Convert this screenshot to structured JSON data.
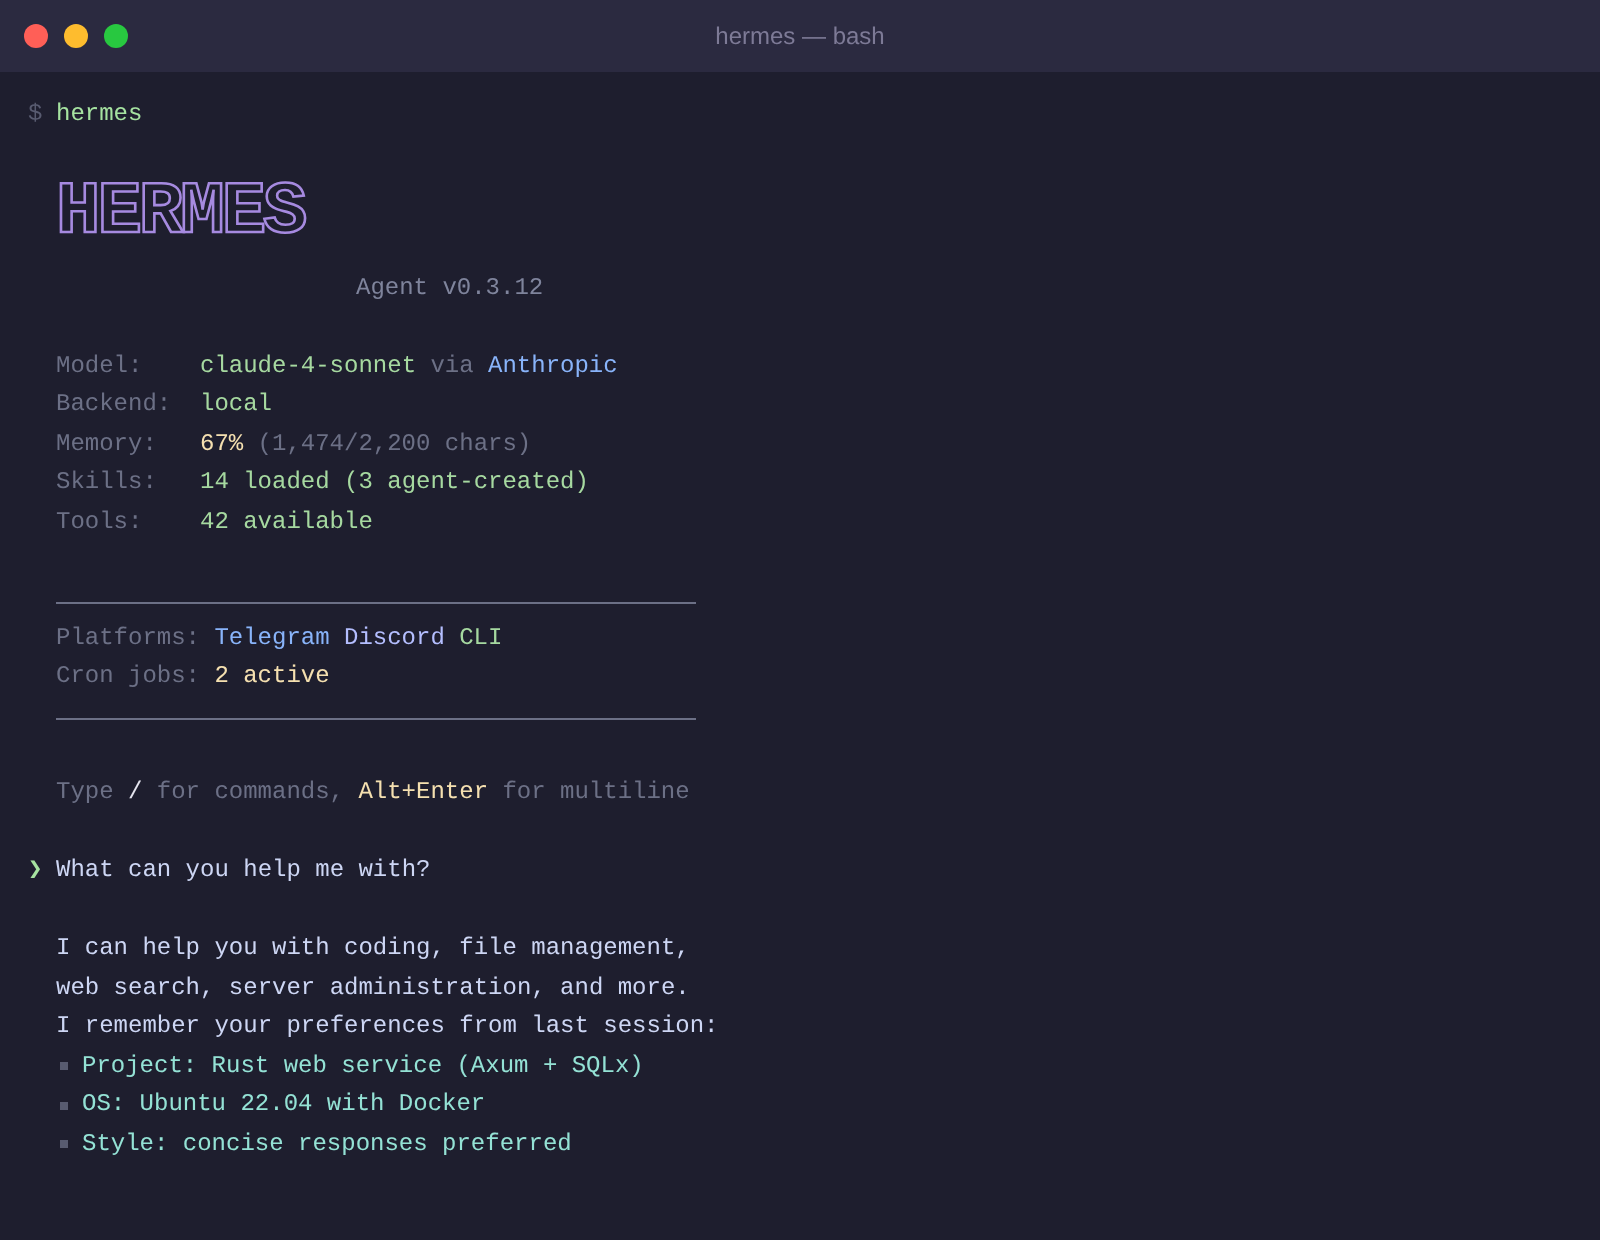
{
  "window": {
    "title": "hermes — bash"
  },
  "command": {
    "prompt": "$",
    "text": "hermes"
  },
  "banner": {
    "logo": "HERMES",
    "version": "Agent v0.3.12"
  },
  "info_rows": [
    {
      "label": "Model:",
      "parts": [
        {
          "text": "claude-4-sonnet",
          "kind": "value"
        },
        {
          "text": "via",
          "kind": "muted"
        },
        {
          "text": "Anthropic",
          "kind": "link"
        }
      ]
    },
    {
      "label": "Backend:",
      "parts": [
        {
          "text": "local",
          "kind": "value"
        }
      ]
    },
    {
      "label": "Memory:",
      "parts": [
        {
          "text": "67%",
          "kind": "highlight"
        },
        {
          "text": "(1,474/2,200 chars)",
          "kind": "muted"
        }
      ]
    },
    {
      "label": "Skills:",
      "parts": [
        {
          "text": "14 loaded (3 agent-created)",
          "kind": "value"
        }
      ]
    },
    {
      "label": "Tools:",
      "parts": [
        {
          "text": "42 available",
          "kind": "value"
        }
      ]
    }
  ],
  "status_rows": [
    {
      "label": "Platforms:",
      "parts": [
        {
          "text": "Telegram",
          "kind": "link"
        },
        {
          "text": "Discord",
          "kind": "accent"
        },
        {
          "text": "CLI",
          "kind": "value"
        }
      ]
    },
    {
      "label": "Cron jobs:",
      "parts": [
        {
          "text": "2 active",
          "kind": "highlight"
        }
      ]
    }
  ],
  "hint": [
    {
      "text": "Type",
      "kind": "muted"
    },
    {
      "text": "/",
      "kind": "bright"
    },
    {
      "text": "for commands,",
      "kind": "muted"
    },
    {
      "text": "Alt+Enter",
      "kind": "highlight"
    },
    {
      "text": "for multiline",
      "kind": "muted"
    }
  ],
  "user_prompt": {
    "marker": "❯",
    "text": "What can you help me with?"
  },
  "response": {
    "lines": [
      "I can help you with coding, file management,",
      "web search, server administration, and more.",
      "I remember your preferences from last session:"
    ],
    "bullets": [
      "Project: Rust web service (Axum + SQLx)",
      "OS: Ubuntu 22.04 with Docker",
      "Style: concise responses preferred"
    ]
  }
}
